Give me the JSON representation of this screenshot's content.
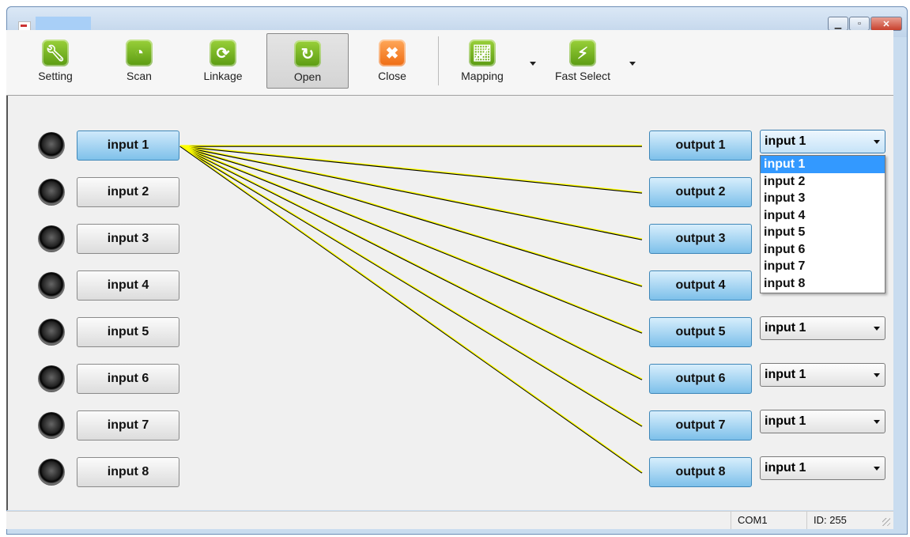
{
  "toolbar": {
    "items": [
      {
        "label": "Setting",
        "icon": "wrench-icon",
        "color": "#6fb021"
      },
      {
        "label": "Scan",
        "icon": "scan-icon",
        "color": "#6fb021"
      },
      {
        "label": "Linkage",
        "icon": "refresh-icon",
        "color": "#6fb021"
      },
      {
        "label": "Open",
        "icon": "sync-icon",
        "color": "#6fb021",
        "active": true
      },
      {
        "label": "Close",
        "icon": "close-icon",
        "color": "#f07d2a"
      },
      {
        "label": "Mapping",
        "icon": "chart-icon",
        "color": "#6fb021",
        "has_dropdown": true
      },
      {
        "label": "Fast Select",
        "icon": "bolt-icon",
        "color": "#6fb021",
        "has_dropdown": true
      }
    ]
  },
  "inputs": [
    "input 1",
    "input 2",
    "input 3",
    "input 4",
    "input 5",
    "input 6",
    "input 7",
    "input 8"
  ],
  "selected_input": "input 1",
  "outputs": [
    "output 1",
    "output 2",
    "output 3",
    "output 4",
    "output 5",
    "output 6",
    "output 7",
    "output 8"
  ],
  "output_selections": [
    "input 1",
    "",
    "",
    "",
    "input 1",
    "input 1",
    "input 1",
    "input 1"
  ],
  "dropdown": {
    "for_output": "output 1",
    "options": [
      "input 1",
      "input 2",
      "input 3",
      "input 4",
      "input 5",
      "input 6",
      "input 7",
      "input 8"
    ],
    "highlighted": "input 1"
  },
  "connection_color": "#ffff00",
  "status": {
    "port": "COM1",
    "id": "ID: 255"
  }
}
